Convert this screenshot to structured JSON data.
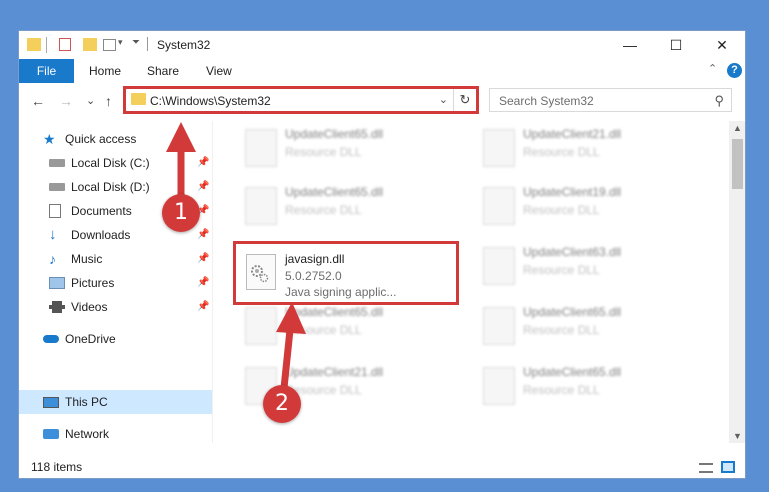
{
  "window": {
    "title": "System32",
    "controls": {
      "minimize": "—",
      "maximize": "☐",
      "close": "✕"
    }
  },
  "ribbon": {
    "tabs": [
      "File",
      "Home",
      "Share",
      "View"
    ],
    "collapse_icon": "⌃",
    "help_label": "?"
  },
  "nav": {
    "back": "←",
    "forward": "→",
    "recent": "⌄",
    "up": "↑",
    "address": "C:\\Windows\\System32",
    "address_dropdown": "⌄",
    "refresh": "↻",
    "search_placeholder": "Search System32",
    "search_icon": "⚲"
  },
  "sidebar": {
    "items": [
      {
        "label": "Quick access",
        "icon": "star-icon",
        "pinned": false
      },
      {
        "label": "Local Disk (C:)",
        "icon": "drive-icon",
        "pinned": true
      },
      {
        "label": "Local Disk (D:)",
        "icon": "drive-icon",
        "pinned": true
      },
      {
        "label": "Documents",
        "icon": "document-icon",
        "pinned": true
      },
      {
        "label": "Downloads",
        "icon": "download-icon",
        "pinned": true
      },
      {
        "label": "Music",
        "icon": "music-icon",
        "pinned": true
      },
      {
        "label": "Pictures",
        "icon": "pictures-icon",
        "pinned": true
      },
      {
        "label": "Videos",
        "icon": "video-icon",
        "pinned": true
      },
      {
        "label": "OneDrive",
        "icon": "cloud-icon",
        "pinned": false
      },
      {
        "label": "This PC",
        "icon": "computer-icon",
        "pinned": false,
        "selected": true
      },
      {
        "label": "Network",
        "icon": "network-icon",
        "pinned": false
      }
    ],
    "pin_glyph": "📌"
  },
  "files": {
    "blurred": [
      {
        "name": "UpdateClient65.dll",
        "desc": "Resource DLL"
      },
      {
        "name": "UpdateClient21.dll",
        "desc": "Resource DLL"
      },
      {
        "name": "UpdateClient65.dll",
        "desc": "Resource DLL"
      },
      {
        "name": "UpdateClient19.dll",
        "desc": "Resource DLL"
      },
      {
        "name": "UpdateClient63.dll",
        "desc": "Resource DLL"
      },
      {
        "name": "UpdateClient65.dll",
        "desc": "Resource DLL"
      },
      {
        "name": "UpdateClient65.dll",
        "desc": "Resource DLL"
      },
      {
        "name": "UpdateClient21.dll",
        "desc": "Resource DLL"
      },
      {
        "name": "UpdateClient65.dll",
        "desc": "Resource DLL"
      }
    ],
    "highlighted": {
      "name": "javasign.dll",
      "version": "5.0.2752.0",
      "description": "Java signing applic..."
    }
  },
  "status": {
    "item_count": "118 items"
  },
  "annotations": {
    "step1": "1",
    "step2": "2",
    "color": "#d23a3a"
  }
}
